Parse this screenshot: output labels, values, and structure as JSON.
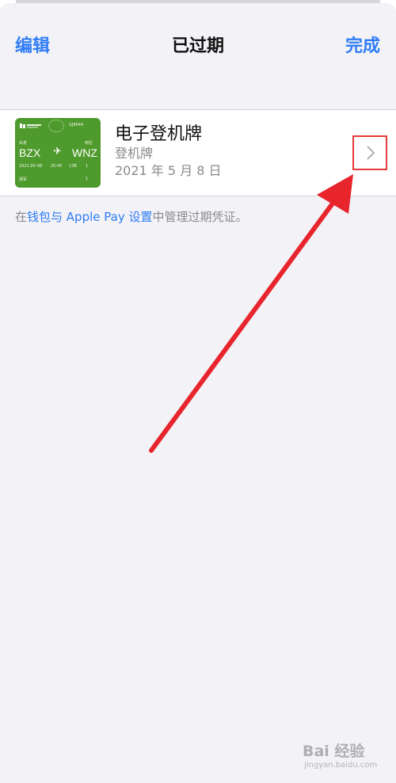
{
  "nav": {
    "left_label": "编辑",
    "title": "已过期",
    "right_label": "完成"
  },
  "pass_item": {
    "title": "电子登机牌",
    "subtitle": "登机牌",
    "date": "2021 年 5 月 8 日",
    "card": {
      "airline_logo": "tibet-airlines-logo",
      "flight_no": "GJ8644",
      "from": "BZX",
      "to": "WNZ",
      "date": "2021-05-08",
      "time": "20:45",
      "gate": "13B",
      "seq": "1",
      "passenger": "胡军",
      "background_color": "#4f9a2c"
    },
    "chevron_icon": "chevron-right-icon"
  },
  "footer": {
    "prefix": "在",
    "link": "钱包与 Apple Pay 设置",
    "suffix": "中管理过期凭证。"
  },
  "colors": {
    "accent": "#2f7cf6",
    "annotation": "#e53a3a",
    "background": "#f2f2f7"
  },
  "watermark": {
    "text": "Bai 经验",
    "sub": "jingyan.baidu.com"
  }
}
